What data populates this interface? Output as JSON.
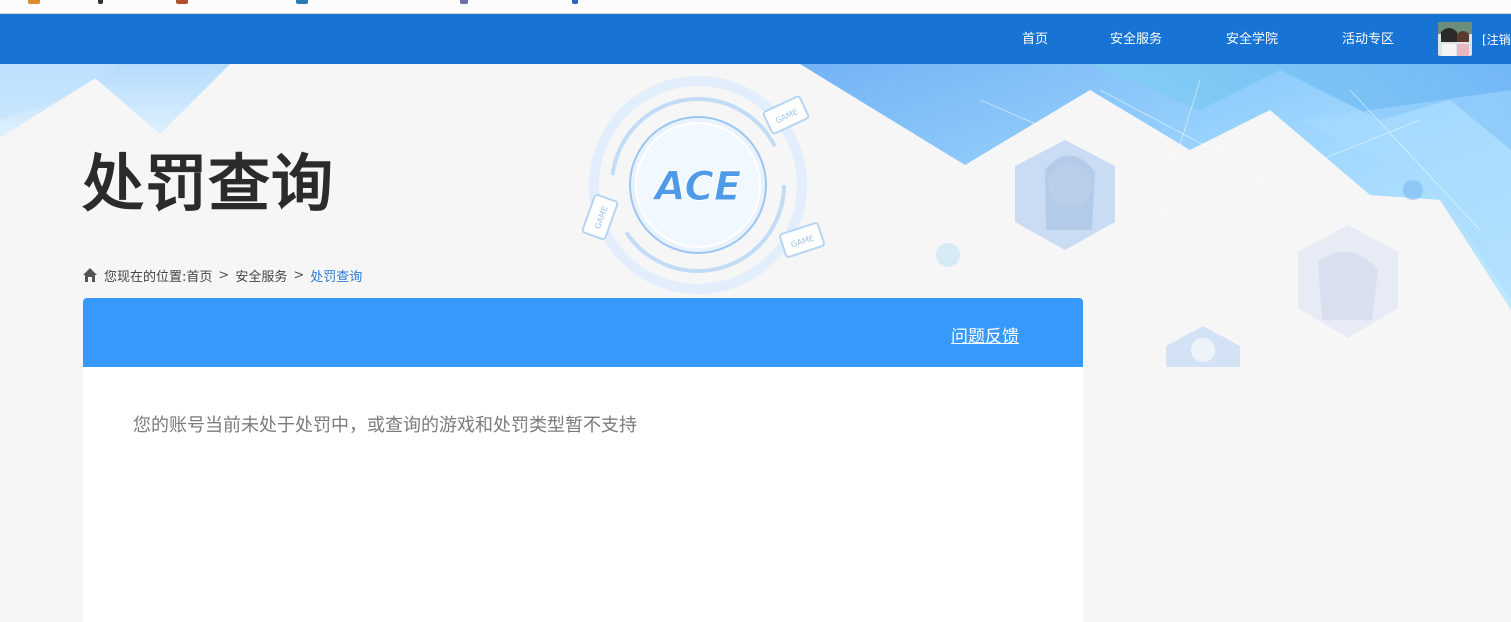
{
  "nav": {
    "items": [
      {
        "label": "首页"
      },
      {
        "label": "安全服务"
      },
      {
        "label": "安全学院"
      },
      {
        "label": "活动专区"
      }
    ],
    "logout_label": "[注销"
  },
  "logo": {
    "text": "ACE"
  },
  "page": {
    "title": "处罚查询"
  },
  "breadcrumb": {
    "prefix": "您现在的位置:",
    "items": [
      "首页",
      "安全服务",
      "处罚查询"
    ],
    "separator": ">"
  },
  "panel": {
    "feedback_label": "问题反馈",
    "message": "您的账号当前未处于处罚中，或查询的游戏和处罚类型暂不支持"
  },
  "colors": {
    "nav_bg": "#1773d4",
    "panel_head": "#3799fc",
    "breadcrumb_current": "#2b7ad3"
  }
}
